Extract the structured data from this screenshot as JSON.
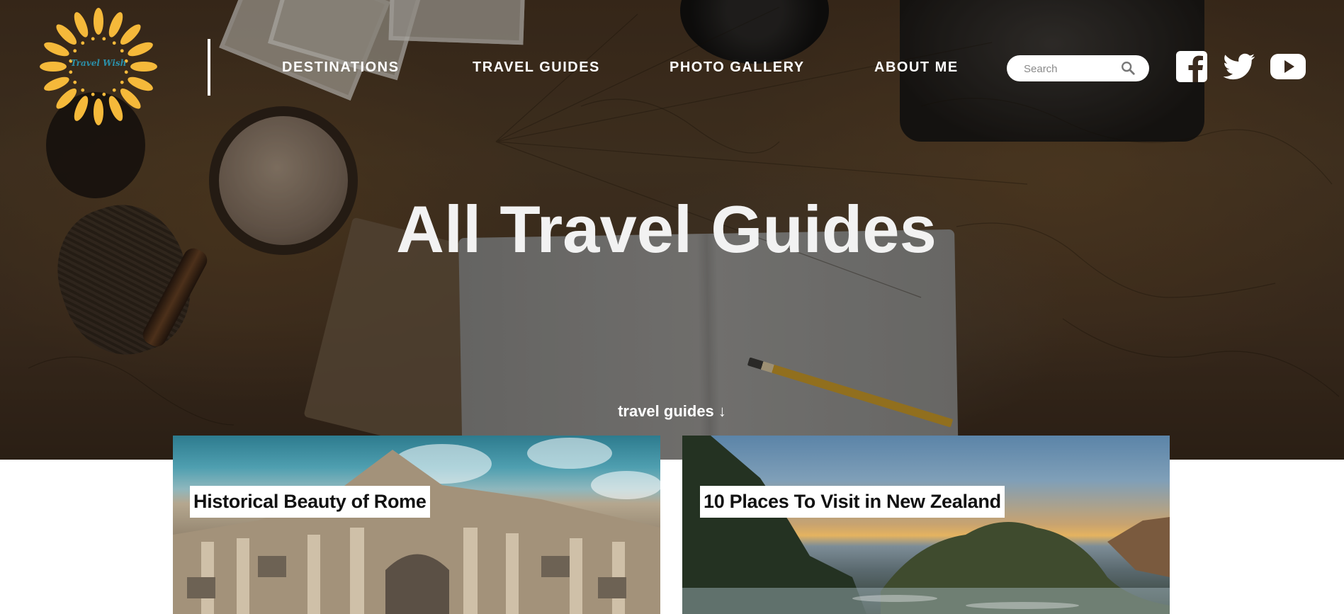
{
  "header": {
    "logo_text": "Travel Wish",
    "nav": [
      {
        "label": "DESTINATIONS"
      },
      {
        "label": "TRAVEL GUIDES"
      },
      {
        "label": "PHOTO GALLERY"
      },
      {
        "label": "ABOUT ME"
      }
    ],
    "search": {
      "placeholder": "Search",
      "value": ""
    },
    "social": [
      {
        "icon": "facebook-icon"
      },
      {
        "icon": "twitter-icon"
      },
      {
        "icon": "youtube-icon"
      }
    ]
  },
  "hero": {
    "title": "All Travel Guides",
    "scroll_cue": "travel guides ↓"
  },
  "guides": [
    {
      "title": "Historical Beauty of Rome"
    },
    {
      "title": "10 Places To Visit in New Zealand"
    }
  ],
  "colors": {
    "logo_sun": "#f5b93a",
    "logo_text": "#2b8fa8",
    "hero_overlay": "#3b2b1d",
    "text_on_hero": "#ffffff"
  }
}
